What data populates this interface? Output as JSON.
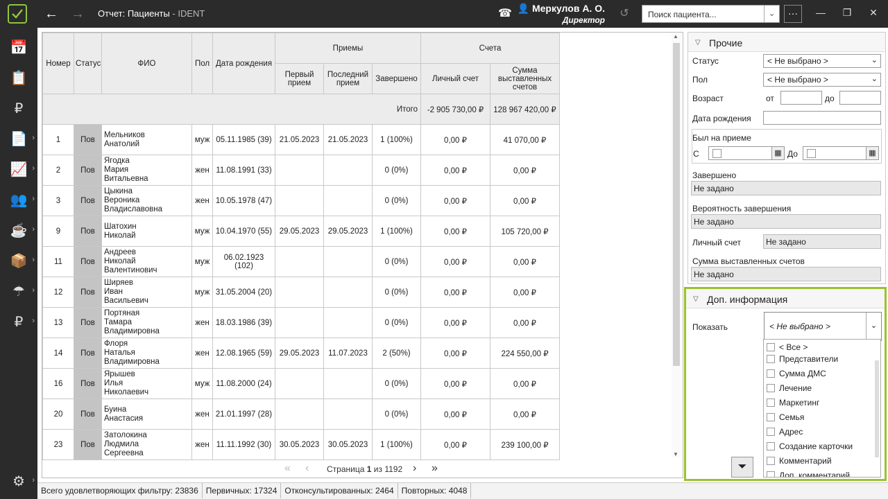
{
  "header": {
    "title": "Отчет: Пациенты",
    "title_suffix": " - IDENT",
    "user_name": "Меркулов А. О.",
    "user_role": "Директор",
    "search_placeholder": "Поиск пациента...",
    "more": "···"
  },
  "table": {
    "headers": {
      "num": "Номер",
      "status": "Статус",
      "fio": "ФИО",
      "sex": "Пол",
      "dob": "Дата рождения",
      "visits": "Приемы",
      "first": "Первый прием",
      "last": "Последний прием",
      "done": "Завершено",
      "accounts": "Счета",
      "personal": "Личный счет",
      "sum": "Сумма выставленных счетов"
    },
    "total": {
      "label": "Итого",
      "personal": "-2 905 730,00 ₽",
      "sum": "128 967 420,00 ₽"
    },
    "rows": [
      {
        "num": "1",
        "status": "Пов",
        "fio": "Мельников\nАнатолий",
        "sex": "муж",
        "dob": "05.11.1985 (39)",
        "first": "21.05.2023",
        "last": "21.05.2023",
        "done": "1 (100%)",
        "personal": "0,00 ₽",
        "sum": "41 070,00 ₽"
      },
      {
        "num": "2",
        "status": "Пов",
        "fio": "Ягодка\nМария\nВитальевна",
        "sex": "жен",
        "dob": "11.08.1991 (33)",
        "first": "",
        "last": "",
        "done": "0 (0%)",
        "personal": "0,00 ₽",
        "sum": "0,00 ₽"
      },
      {
        "num": "3",
        "status": "Пов",
        "fio": "Цыкина\nВероника\nВладиславовна",
        "sex": "жен",
        "dob": "10.05.1978 (47)",
        "first": "",
        "last": "",
        "done": "0 (0%)",
        "personal": "0,00 ₽",
        "sum": "0,00 ₽"
      },
      {
        "num": "9",
        "status": "Пов",
        "fio": "Шатохин\nНиколай",
        "sex": "муж",
        "dob": "10.04.1970 (55)",
        "first": "29.05.2023",
        "last": "29.05.2023",
        "done": "1 (100%)",
        "personal": "0,00 ₽",
        "sum": "105 720,00 ₽"
      },
      {
        "num": "11",
        "status": "Пов",
        "fio": "Андреев\nНиколай\nВалентинович",
        "sex": "муж",
        "dob": "06.02.1923 (102)",
        "first": "",
        "last": "",
        "done": "0 (0%)",
        "personal": "0,00 ₽",
        "sum": "0,00 ₽"
      },
      {
        "num": "12",
        "status": "Пов",
        "fio": "Ширяев\nИван\nВасильевич",
        "sex": "муж",
        "dob": "31.05.2004 (20)",
        "first": "",
        "last": "",
        "done": "0 (0%)",
        "personal": "0,00 ₽",
        "sum": "0,00 ₽"
      },
      {
        "num": "13",
        "status": "Пов",
        "fio": "Портяная\nТамара\nВладимировна",
        "sex": "жен",
        "dob": "18.03.1986 (39)",
        "first": "",
        "last": "",
        "done": "0 (0%)",
        "personal": "0,00 ₽",
        "sum": "0,00 ₽"
      },
      {
        "num": "14",
        "status": "Пов",
        "fio": "Флоря\nНаталья\nВладимировна",
        "sex": "жен",
        "dob": "12.08.1965 (59)",
        "first": "29.05.2023",
        "last": "11.07.2023",
        "done": "2 (50%)",
        "personal": "0,00 ₽",
        "sum": "224 550,00 ₽"
      },
      {
        "num": "16",
        "status": "Пов",
        "fio": "Ярышев\nИлья\nНиколаевич",
        "sex": "муж",
        "dob": "11.08.2000 (24)",
        "first": "",
        "last": "",
        "done": "0 (0%)",
        "personal": "0,00 ₽",
        "sum": "0,00 ₽"
      },
      {
        "num": "20",
        "status": "Пов",
        "fio": "Буина\nАнастасия",
        "sex": "жен",
        "dob": "21.01.1997 (28)",
        "first": "",
        "last": "",
        "done": "0 (0%)",
        "personal": "0,00 ₽",
        "sum": "0,00 ₽"
      },
      {
        "num": "23",
        "status": "Пов",
        "fio": "Затолокина\nЛюдмила\nСергеевна",
        "sex": "жен",
        "dob": "11.11.1992 (30)",
        "first": "30.05.2023",
        "last": "30.05.2023",
        "done": "1 (100%)",
        "personal": "0,00 ₽",
        "sum": "239 100,00 ₽"
      }
    ]
  },
  "pager": {
    "prefix": "Страница",
    "page": "1",
    "of": "из",
    "total": "1192"
  },
  "status_bar": [
    "Всего удовлетворяющих фильтру: 23836",
    "Первичных: 17324",
    "Отконсультированных: 2464",
    "Повторных: 4048"
  ],
  "filters": {
    "section": "Прочие",
    "status_label": "Статус",
    "status_value": "< Не выбрано >",
    "sex_label": "Пол",
    "sex_value": "< Не выбрано >",
    "age_label": "Возраст",
    "age_from": "от",
    "age_to": "до",
    "dob_label": "Дата рождения",
    "visit_label": "Был на приеме",
    "visit_from": "С",
    "visit_to": "До",
    "done_label": "Завершено",
    "done_value": "Не задано",
    "prob_label": "Вероятность завершения",
    "prob_value": "Не задано",
    "personal_label": "Личный счет",
    "personal_value": "Не задано",
    "sum_label": "Сумма выставленных счетов",
    "sum_value": "Не задано"
  },
  "dop": {
    "section": "Доп. информация",
    "show_label": "Показать",
    "show_value": "< Не выбрано >",
    "options": [
      "< Все >",
      "Представители",
      "Сумма ДМС",
      "Лечение",
      "Маркетинг",
      "Семья",
      "Адрес",
      "Создание карточки",
      "Комментарий",
      "Доп. комментарий"
    ]
  },
  "colors": {
    "accent": "#9ac32b",
    "topbar": "#2b2b2b"
  }
}
